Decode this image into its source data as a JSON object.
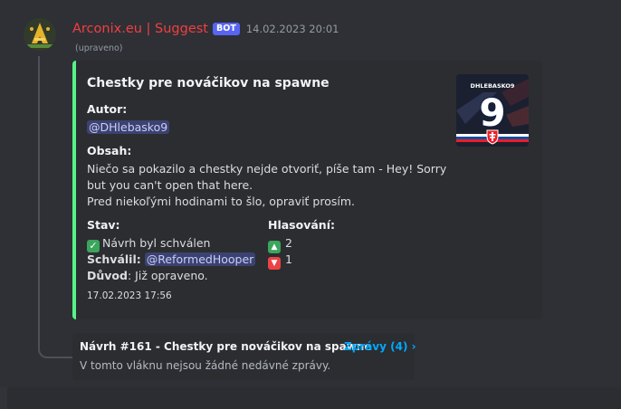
{
  "message": {
    "author": "Arconix.eu | Suggest",
    "bot_tag": "BOT",
    "timestamp": "14.02.2023 20:01",
    "edited": "(upraveno)"
  },
  "embed": {
    "accent_color": "#57f287",
    "title": "Chestky pre nováčikov na spawne",
    "author_label": "Autor:",
    "author_mention": "@DHlebasko9",
    "content_label": "Obsah:",
    "content_lines": [
      "Niečo sa pokazilo a chestky nejde otvoriť, píše tam - Hey! Sorry",
      "but you can't open that here.",
      "Pred niekoľými hodinami to šlo, opraviť prosím."
    ],
    "status_label": "Stav:",
    "status_value": "Návrh byl schválen",
    "approved_by_label": "Schválil:",
    "approved_by_mention": "@ReformedHooper",
    "reason_label": "Důvod",
    "reason_value": ": Již opraveno.",
    "votes_label": "Hlasování:",
    "votes_up": "2",
    "votes_down": "1",
    "footer_timestamp": "17.02.2023 17:56",
    "thumbnail": {
      "name_text": "DHLEBASKO9",
      "number": "9"
    }
  },
  "thread": {
    "title": "Návrh #161 - Chestky pre nováčikov na spawne",
    "messages_link": "Zprávy (4) ›",
    "empty_text": "V tomto vláknu nejsou žádné nedávné zprávy."
  },
  "colors": {
    "background": "#313338",
    "embed_background": "#2b2d31",
    "username": "#f23f42",
    "bot_tag": "#5865f2",
    "link": "#00a8fc",
    "mention_bg": "#3c4270"
  }
}
